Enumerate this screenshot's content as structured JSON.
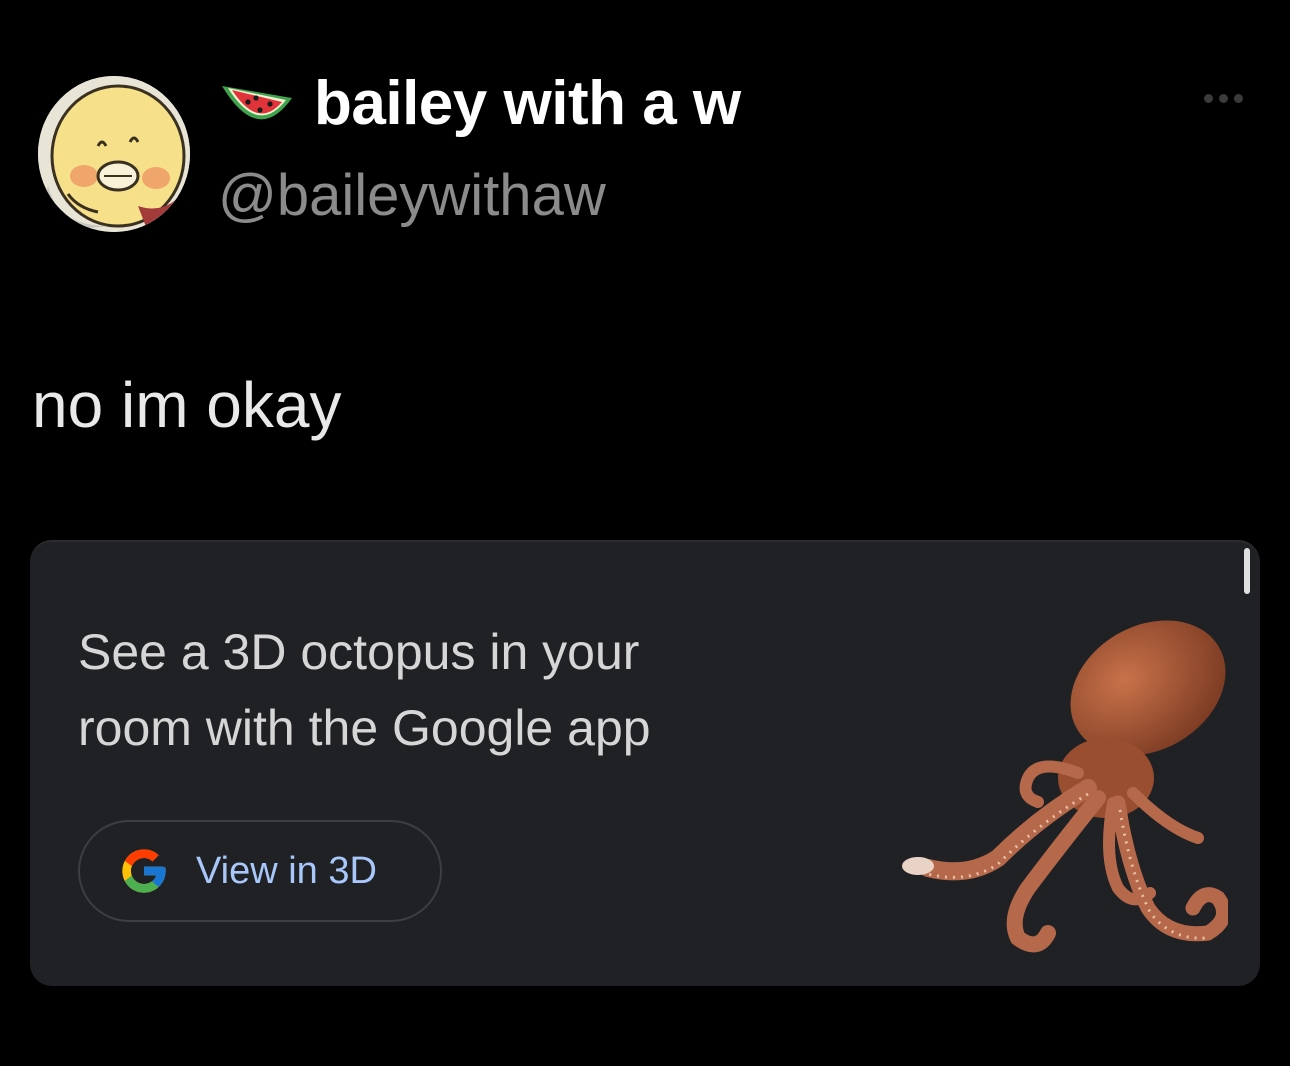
{
  "tweet": {
    "display_name": "bailey with a w",
    "handle": "@baileywithaw",
    "emoji_icon": "watermelon-icon",
    "text": "no im okay"
  },
  "card": {
    "title_line1": "See a 3D octopus in your",
    "title_line2": "room with the Google app",
    "button_label": "View in 3D",
    "button_icon": "google-g-icon",
    "image": "octopus-3d-model"
  },
  "colors": {
    "background": "#000000",
    "card_background": "#202124",
    "button_text": "#a8c7fa",
    "handle": "#8b8b8b"
  }
}
